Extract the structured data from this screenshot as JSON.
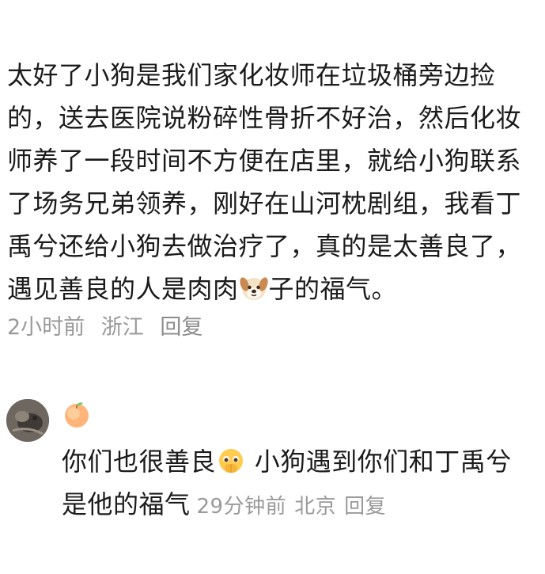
{
  "comment": {
    "text_part1": "太好了小狗是我们家化妆师在垃圾桶旁边捡的，送去医院说粉碎性骨折不好治，然后化妆师养了一段时间不方便在店里，就给小狗联系了场务兄弟领养，刚好在山河枕剧组，我看丁禹兮还给小狗去做治疗了，真的是太善良了，遇见善良的人是肉肉",
    "emoji_icon": "dog-face-icon",
    "text_part2": "子的福气。",
    "time": "2小时前",
    "location": "浙江",
    "reply_label": "回复"
  },
  "reply": {
    "avatar_icon": "user-avatar",
    "badge_icon": "peach-icon",
    "text_part1": "你们也很善良",
    "emoji_icon": "pleading-face-icon",
    "text_part2": " 小狗遇到你们和丁禹兮是他的福气",
    "time": "29分钟前",
    "location": "北京",
    "reply_label": "回复"
  },
  "colors": {
    "text": "#1b1b1b",
    "meta": "#9a9a9a",
    "background": "#ffffff"
  }
}
